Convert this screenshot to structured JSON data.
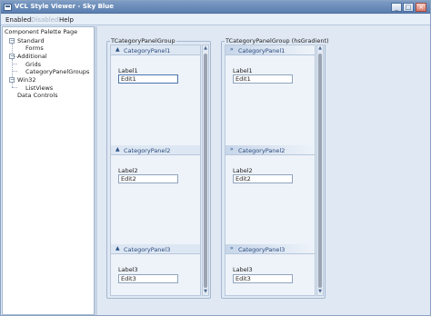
{
  "window": {
    "title": "VCL Style Viewer - Sky Blue"
  },
  "title_buttons": {
    "minimize": "_",
    "maximize": "□",
    "close": "×"
  },
  "menu": {
    "enabled": "Enabled",
    "disabled": "Disabled",
    "help": "Help"
  },
  "tree": {
    "header": "Component Palette Page",
    "items": {
      "standard": "Standard",
      "forms": "Forms",
      "additional": "Additional",
      "grids": "Grids",
      "category_panel_groups": "CategoryPanelGroups",
      "win32": "Win32",
      "listviews": "ListViews",
      "data_controls": "Data Controls"
    },
    "expander_symbol": "−"
  },
  "groups": [
    {
      "caption": "TCategoryPanelGroup",
      "chevron": "▲",
      "panels": [
        {
          "caption": "CategoryPanel1",
          "label": "Label1",
          "edit": "Edit1"
        },
        {
          "caption": "CategoryPanel2",
          "label": "Label2",
          "edit": "Edit2"
        },
        {
          "caption": "CategoryPanel3",
          "label": "Label3",
          "edit": "Edit3"
        }
      ]
    },
    {
      "caption": "TCategoryPanelGroup (hsGradient)",
      "chevron": "»",
      "panels": [
        {
          "caption": "CategoryPanel1",
          "label": "Label1",
          "edit": "Edit1"
        },
        {
          "caption": "CategoryPanel2",
          "label": "Label2",
          "edit": "Edit2"
        },
        {
          "caption": "CategoryPanel3",
          "label": "Label3",
          "edit": "Edit3"
        }
      ]
    }
  ],
  "scrollbar": {
    "up": "▲",
    "down": "▼"
  },
  "colors": {
    "title_bar": "#5b7fb0",
    "panel_header": "#dde7f3",
    "accent_text": "#2c4c7e"
  }
}
